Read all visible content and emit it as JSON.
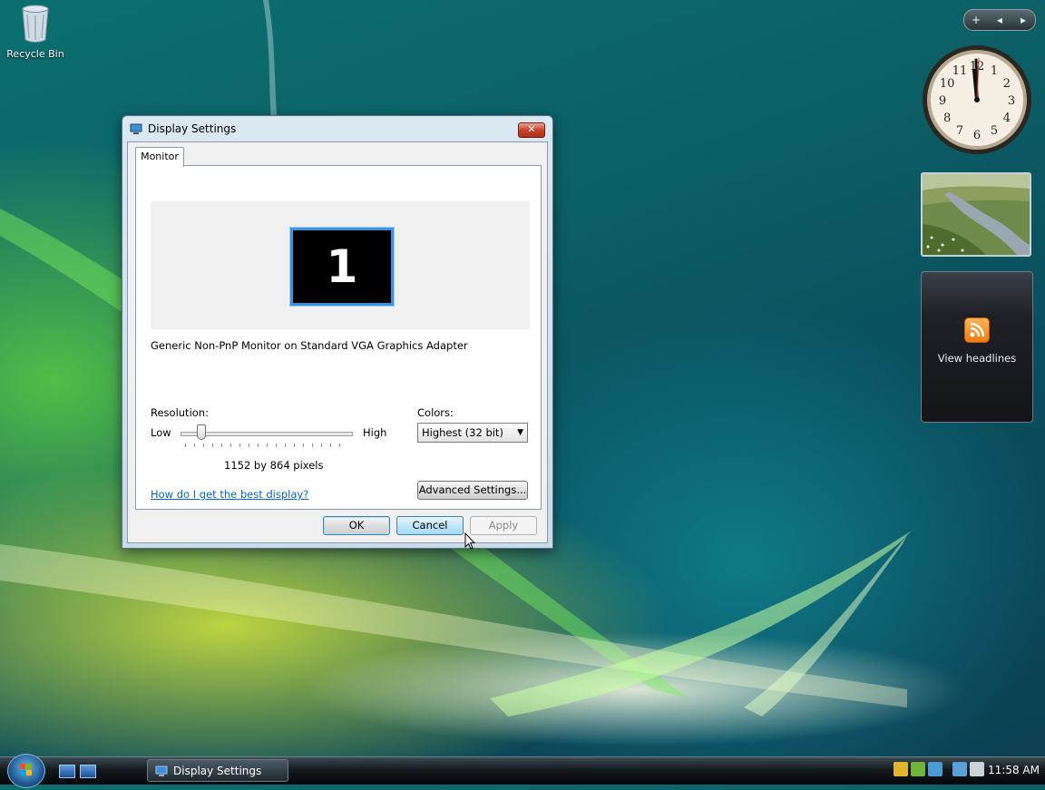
{
  "desktop": {
    "recycle_bin_label": "Recycle Bin"
  },
  "gadgets": {
    "control_plus": "+",
    "control_prev": "◂",
    "control_next": "▸",
    "clock_numbers": [
      "12",
      "1",
      "2",
      "3",
      "4",
      "5",
      "6",
      "7",
      "8",
      "9",
      "10",
      "11"
    ],
    "feed_text": "View headlines"
  },
  "dialog": {
    "title": "Display Settings",
    "close_label": "✕",
    "tab_label": "Monitor",
    "monitor_number": "1",
    "monitor_name": "Generic Non-PnP Monitor on Standard VGA Graphics Adapter",
    "resolution_label": "Resolution:",
    "low_label": "Low",
    "high_label": "High",
    "resolution_value": "1152 by 864 pixels",
    "resolution_slider_level": 0.12,
    "colors_label": "Colors:",
    "colors_selected": "Highest (32 bit)",
    "help_link": "How do I get the best display?",
    "advanced_button": "Advanced Settings...",
    "ok_button": "OK",
    "cancel_button": "Cancel",
    "apply_button": "Apply"
  },
  "taskbar": {
    "task_label": "Display Settings",
    "time": "11:58 AM"
  },
  "icons": [
    "recycle-bin-icon",
    "display-settings-icon",
    "rss-icon",
    "start-orb-icon",
    "show-desktop-icon",
    "switch-windows-icon",
    "shield-icon",
    "network-icon",
    "volume-icon"
  ],
  "colors": {
    "accent": "#3a92e0",
    "link": "#0066cc",
    "close": "#c8422d"
  }
}
